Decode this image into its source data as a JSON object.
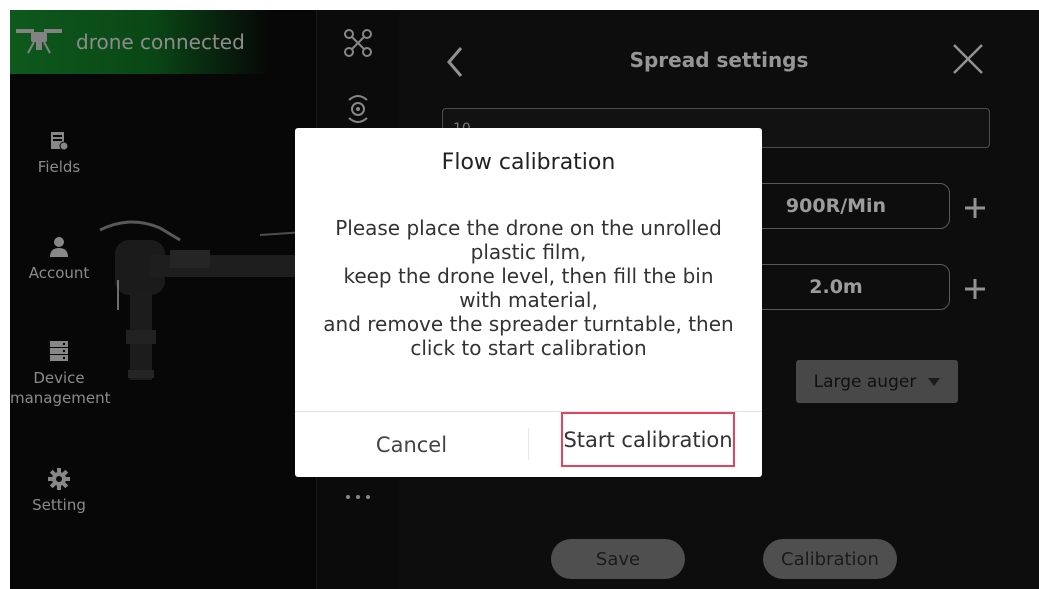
{
  "status": {
    "label": "drone connected",
    "icon": "drone-icon"
  },
  "sidebar": {
    "items": [
      {
        "label": "Fields",
        "icon": "fields-icon"
      },
      {
        "label": "Account",
        "icon": "account-icon"
      },
      {
        "label": "Device management",
        "icon": "device-icon"
      },
      {
        "label": "Setting",
        "icon": "gear-icon"
      }
    ]
  },
  "panel": {
    "title": "Spread settings",
    "name_value": "10",
    "rotation_speed": "900R/Min",
    "spread_width": "2.0m",
    "auger_selected": "Large auger",
    "save_label": "Save",
    "calibration_label": "Calibration"
  },
  "dialog": {
    "title": "Flow calibration",
    "lines": [
      "Please place the drone on the unrolled",
      "plastic film,",
      "keep the drone level, then fill the bin",
      "with material,",
      "and remove the spreader turntable, then",
      "click to start calibration"
    ],
    "cancel_label": "Cancel",
    "start_label": "Start calibration"
  },
  "colors": {
    "accent_green": "#168a2c",
    "highlight": "#e0455d"
  }
}
